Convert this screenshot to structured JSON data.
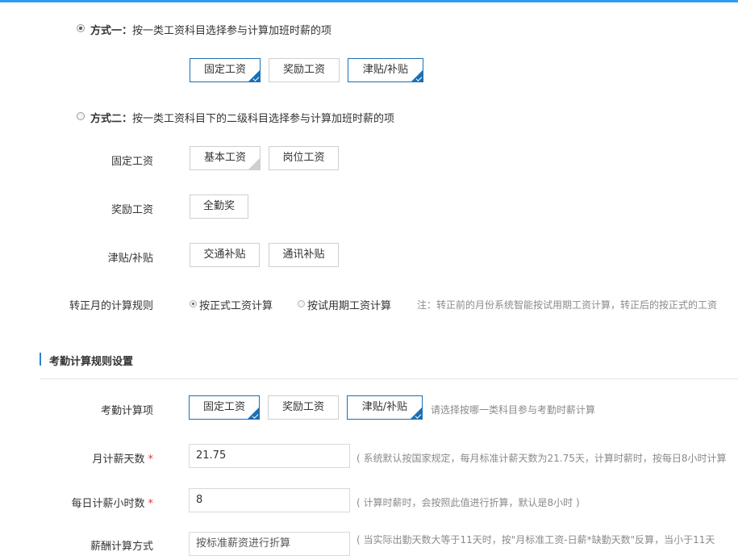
{
  "method1": {
    "title": "方式一：",
    "desc": "按一类工资科目选择参与计算加班时薪的项",
    "selected": true,
    "chips": [
      {
        "label": "固定工资",
        "selected": true
      },
      {
        "label": "奖励工资",
        "selected": false
      },
      {
        "label": "津贴/补贴",
        "selected": true
      }
    ]
  },
  "method2": {
    "title": "方式二：",
    "desc": "按一类工资科目下的二级科目选择参与计算加班时薪的项",
    "selected": false,
    "groups": [
      {
        "label": "固定工资",
        "chips": [
          "基本工资",
          "岗位工资"
        ]
      },
      {
        "label": "奖励工资",
        "chips": [
          "全勤奖"
        ]
      },
      {
        "label": "津贴/补贴",
        "chips": [
          "交通补贴",
          "通讯补贴"
        ]
      }
    ]
  },
  "probation": {
    "label": "转正月的计算规则",
    "options": [
      {
        "label": "按正式工资计算",
        "selected": true
      },
      {
        "label": "按试用期工资计算",
        "selected": false
      }
    ],
    "note": "注：转正前的月份系统智能按试用期工资计算，转正后的按正式的工资"
  },
  "attendance": {
    "section_title": "考勤计算规则设置",
    "items_label": "考勤计算项",
    "items": [
      {
        "label": "固定工资",
        "selected": true
      },
      {
        "label": "奖励工资",
        "selected": false
      },
      {
        "label": "津贴/补贴",
        "selected": true
      }
    ],
    "items_hint": "请选择按哪一类科目参与考勤时薪计算",
    "days_label": "月计薪天数",
    "days_value": "21.75",
    "days_hint": "( 系统默认按国家规定，每月标准计薪天数为21.75天，计算时薪时，按每日8小时计算",
    "hours_label": "每日计薪小时数",
    "hours_value": "8",
    "hours_hint": "( 计算时薪时，会按照此值进行折算，默认是8小时 )",
    "salary_label": "薪酬计算方式",
    "salary_value": "按标准薪资进行折算",
    "salary_hint": "( 当实际出勤天数大等于11天时，按\"月标准工资-日薪*缺勤天数\"反算，当小于11天"
  },
  "required_mark": "*"
}
